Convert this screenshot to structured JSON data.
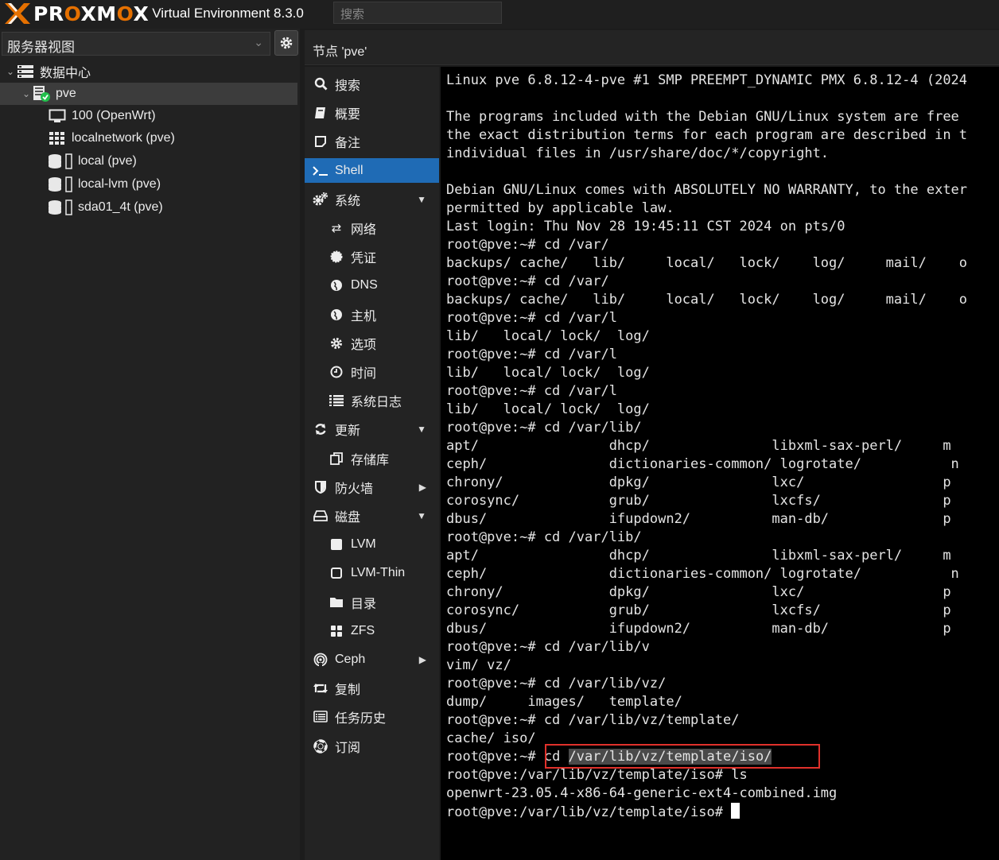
{
  "topbar": {
    "logo_text_1": "PR",
    "logo_text_o1": "O",
    "logo_text_2": "XM",
    "logo_text_o2": "O",
    "logo_text_3": "X",
    "version": "Virtual Environment 8.3.0",
    "search_placeholder": "搜索"
  },
  "left": {
    "view_select": "服务器视图",
    "tree": [
      {
        "label": "数据中心",
        "icon": "datacenter-icon"
      },
      {
        "label": "pve",
        "icon": "node-online-icon"
      },
      {
        "label": "100 (OpenWrt)",
        "icon": "vm-monitor-icon"
      },
      {
        "label": "localnetwork (pve)",
        "icon": "network-grid-icon"
      },
      {
        "label": "local (pve)",
        "icon": "storage-icon"
      },
      {
        "label": "local-lvm (pve)",
        "icon": "storage-icon"
      },
      {
        "label": "sda01_4t (pve)",
        "icon": "storage-icon"
      }
    ]
  },
  "node_header": "节点 'pve'",
  "nav": [
    {
      "label": "搜索",
      "icon": "search-icon"
    },
    {
      "label": "概要",
      "icon": "summary-book-icon"
    },
    {
      "label": "备注",
      "icon": "notes-icon"
    },
    {
      "label": "Shell",
      "icon": "terminal-icon"
    },
    {
      "label": "系统",
      "icon": "cogs-icon"
    },
    {
      "label": "网络",
      "icon": "network-arrows-icon"
    },
    {
      "label": "凭证",
      "icon": "certificate-icon"
    },
    {
      "label": "DNS",
      "icon": "globe-icon"
    },
    {
      "label": "主机",
      "icon": "globe-icon"
    },
    {
      "label": "选项",
      "icon": "gear-icon"
    },
    {
      "label": "时间",
      "icon": "clock-icon"
    },
    {
      "label": "系统日志",
      "icon": "list-icon"
    },
    {
      "label": "更新",
      "icon": "refresh-icon"
    },
    {
      "label": "存储库",
      "icon": "copy-icon"
    },
    {
      "label": "防火墙",
      "icon": "shield-icon"
    },
    {
      "label": "磁盘",
      "icon": "hdd-icon"
    },
    {
      "label": "LVM",
      "icon": "square-icon"
    },
    {
      "label": "LVM-Thin",
      "icon": "square-outline-icon"
    },
    {
      "label": "目录",
      "icon": "folder-icon"
    },
    {
      "label": "ZFS",
      "icon": "th-large-icon"
    },
    {
      "label": "Ceph",
      "icon": "ceph-icon"
    },
    {
      "label": "复制",
      "icon": "retweet-icon"
    },
    {
      "label": "任务历史",
      "icon": "list-alt-icon"
    },
    {
      "label": "订阅",
      "icon": "life-ring-icon"
    }
  ],
  "terminal": {
    "lines": [
      "Linux pve 6.8.12-4-pve #1 SMP PREEMPT_DYNAMIC PMX 6.8.12-4 (2024",
      "",
      "The programs included with the Debian GNU/Linux system are free",
      "the exact distribution terms for each program are described in t",
      "individual files in /usr/share/doc/*/copyright.",
      "",
      "Debian GNU/Linux comes with ABSOLUTELY NO WARRANTY, to the exter",
      "permitted by applicable law.",
      "Last login: Thu Nov 28 19:45:11 CST 2024 on pts/0",
      "root@pve:~# cd /var/",
      "backups/ cache/   lib/     local/   lock/    log/     mail/    o",
      "root@pve:~# cd /var/",
      "backups/ cache/   lib/     local/   lock/    log/     mail/    o",
      "root@pve:~# cd /var/l",
      "lib/   local/ lock/  log/",
      "root@pve:~# cd /var/l",
      "lib/   local/ lock/  log/",
      "root@pve:~# cd /var/l",
      "lib/   local/ lock/  log/",
      "root@pve:~# cd /var/lib/",
      "apt/                dhcp/               libxml-sax-perl/     m",
      "ceph/               dictionaries-common/ logrotate/           n",
      "chrony/             dpkg/               lxc/                 p",
      "corosync/           grub/               lxcfs/               p",
      "dbus/               ifupdown2/          man-db/              p",
      "root@pve:~# cd /var/lib/",
      "apt/                dhcp/               libxml-sax-perl/     m",
      "ceph/               dictionaries-common/ logrotate/           n",
      "chrony/             dpkg/               lxc/                 p",
      "corosync/           grub/               lxcfs/               p",
      "dbus/               ifupdown2/          man-db/              p",
      "root@pve:~# cd /var/lib/v",
      "vim/ vz/",
      "root@pve:~# cd /var/lib/vz/",
      "dump/     images/   template/",
      "root@pve:~# cd /var/lib/vz/template/",
      "cache/ iso/"
    ],
    "hl_prompt": "root@pve:~# ",
    "hl_cmd": "cd ",
    "hl_selected": "/var/lib/vz/template/iso/",
    "line_ls": "root@pve:/var/lib/vz/template/iso# ls",
    "line_file": "openwrt-23.05.4-x86-64-generic-ext4-combined.img",
    "line_prompt": "root@pve:/var/lib/vz/template/iso# "
  }
}
